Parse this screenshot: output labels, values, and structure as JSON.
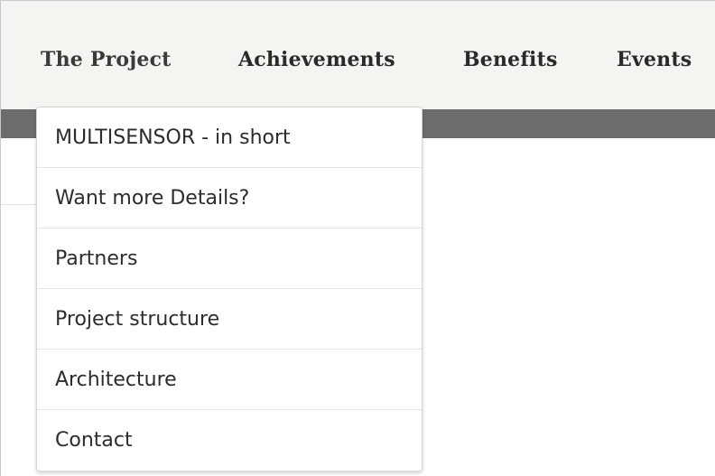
{
  "nav": {
    "items": [
      {
        "label": "The Project",
        "active": true
      },
      {
        "label": "Achievements",
        "active": false
      },
      {
        "label": "Benefits",
        "active": false
      },
      {
        "label": "Events",
        "active": false
      }
    ]
  },
  "dropdown": {
    "items": [
      {
        "label": "MULTISENSOR - in short"
      },
      {
        "label": "Want more Details?"
      },
      {
        "label": "Partners"
      },
      {
        "label": "Project structure"
      },
      {
        "label": "Architecture"
      },
      {
        "label": "Contact"
      }
    ]
  },
  "colors": {
    "navbar_bg": "#f3f5f0",
    "band": "#6d6d6d",
    "text": "#2a2a2a",
    "dropdown_bg": "#ffffff",
    "divider": "#e4e4e4"
  }
}
